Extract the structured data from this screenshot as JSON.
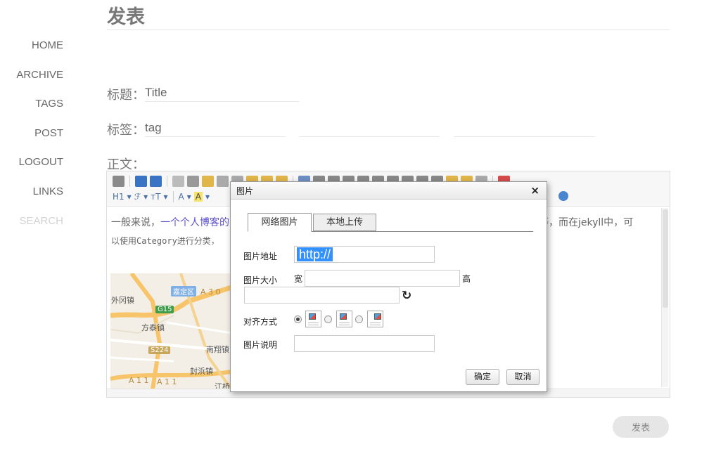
{
  "nav": [
    "HOME",
    "ARCHIVE",
    "TAGS",
    "POST",
    "LOGOUT",
    "LINKS",
    "SEARCH"
  ],
  "page_title": "发表",
  "form": {
    "title_label": "标题：",
    "title_value": "Title",
    "tags_label": "标签：",
    "tag_value": "tag",
    "body_label": "正文："
  },
  "toolbar": {
    "heading": "H1",
    "font_family": "ℱ",
    "font_size": "тT",
    "font_color": "A",
    "back_color": "A"
  },
  "content": {
    "line1_start": "一般来说，",
    "line1_link": "一个个人博客的",
    "line1_end": "等等，而在jekyll中，可",
    "line2": "以使用Category进行分类，"
  },
  "map": {
    "places": [
      "外冈镇",
      "嘉定区",
      "方泰镇",
      "南翔镇",
      "封浜镇",
      "江桥"
    ],
    "roads": [
      "G15",
      "S224",
      "A 3 0",
      "A 1 1",
      "A 1 1"
    ]
  },
  "dialog": {
    "title": "图片",
    "close": "×",
    "tabs": [
      "网络图片",
      "本地上传"
    ],
    "url_label": "图片地址",
    "url_value": "http://",
    "size_label": "图片大小",
    "width_label": "宽",
    "height_label": "高",
    "align_label": "对齐方式",
    "desc_label": "图片说明",
    "ok": "确定",
    "cancel": "取消"
  },
  "publish_button": "发表",
  "colors": {
    "link": "#5a52c8",
    "selection": "#3390ff",
    "publish_bg": "#e6e6e6"
  }
}
